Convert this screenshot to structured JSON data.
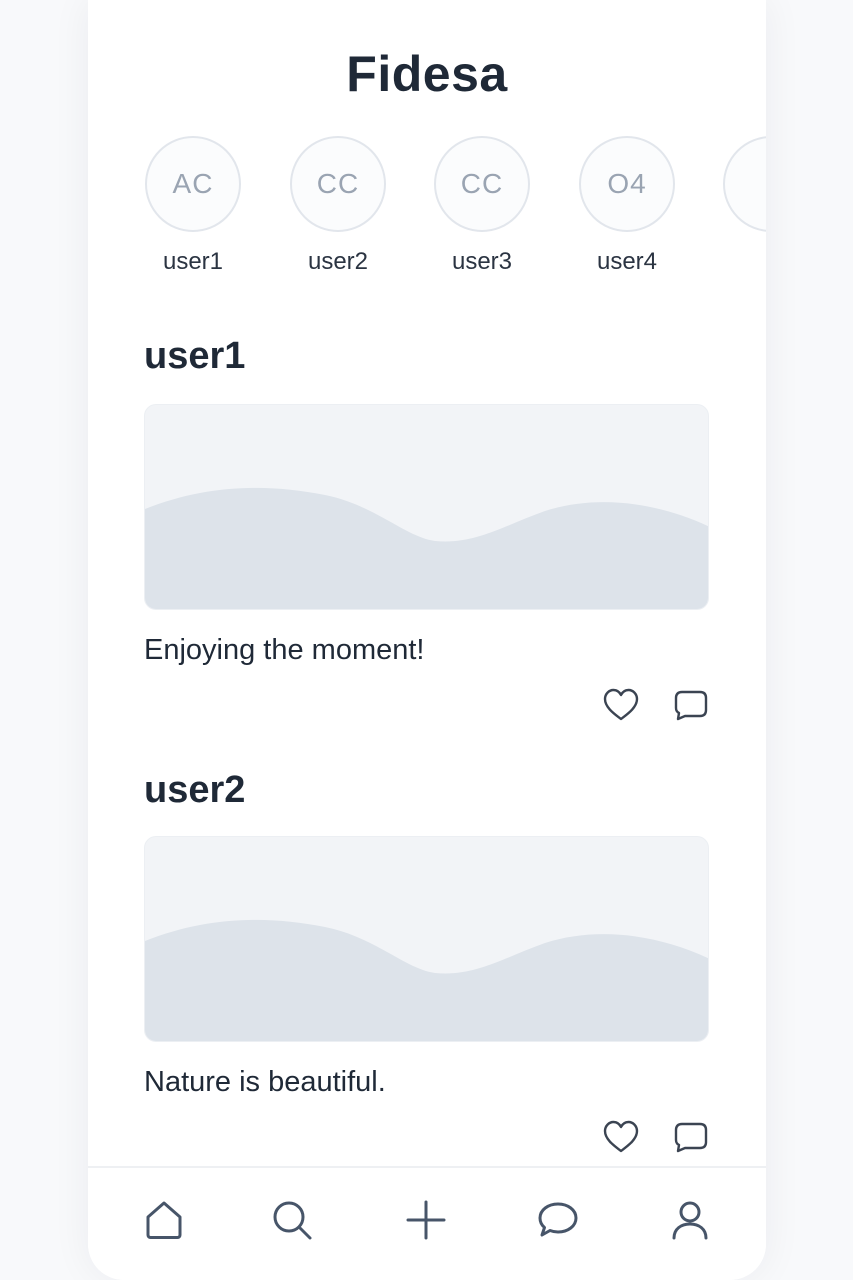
{
  "app": {
    "title": "Fidesa"
  },
  "stories": [
    {
      "initials": "AC",
      "name": "user1"
    },
    {
      "initials": "CC",
      "name": "user2"
    },
    {
      "initials": "CC",
      "name": "user3"
    },
    {
      "initials": "O4",
      "name": "user4"
    },
    {
      "initials": "",
      "name": ""
    }
  ],
  "posts": [
    {
      "username": "user1",
      "caption": "Enjoying the moment!",
      "image_icon": "landscape-placeholder-icon",
      "actions": [
        "heart-icon",
        "comment-icon"
      ]
    },
    {
      "username": "user2",
      "caption": "Nature is beautiful.",
      "image_icon": "landscape-placeholder-icon",
      "actions": [
        "heart-icon",
        "comment-icon"
      ]
    }
  ],
  "bottom_nav": {
    "items": [
      "home-icon",
      "search-icon",
      "plus-icon",
      "chat-icon",
      "profile-icon"
    ]
  },
  "colors": {
    "text": "#1f2937",
    "icon": "#475569",
    "placeholder_bg": "#f2f4f7",
    "placeholder_wave": "#dde3ea",
    "avatar_border": "#e2e6ec"
  }
}
